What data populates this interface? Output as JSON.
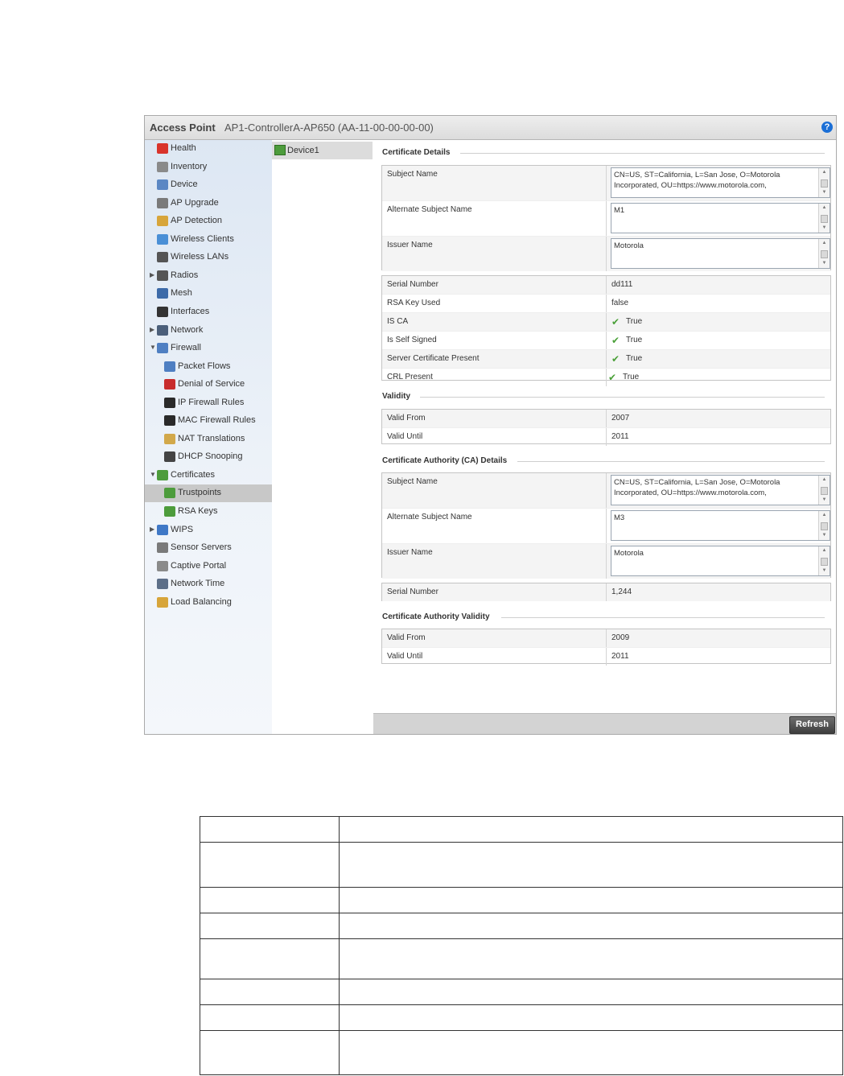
{
  "title": {
    "label": "Access Point",
    "value": "AP1-ControllerA-AP650 (AA-11-00-00-00-00)",
    "help_icon": "help-icon"
  },
  "nav": {
    "items": [
      {
        "label": "Health",
        "icon": "health-icon",
        "color": "#d9342b",
        "level": 0,
        "arrow": ""
      },
      {
        "label": "Inventory",
        "icon": "inventory-icon",
        "color": "#8a8a8a",
        "level": 0,
        "arrow": ""
      },
      {
        "label": "Device",
        "icon": "device-icon",
        "color": "#5b87c4",
        "level": 0,
        "arrow": ""
      },
      {
        "label": "AP Upgrade",
        "icon": "ap-upgrade-icon",
        "color": "#7a7a7a",
        "level": 0,
        "arrow": ""
      },
      {
        "label": "AP Detection",
        "icon": "ap-detection-icon",
        "color": "#d7a53a",
        "level": 0,
        "arrow": ""
      },
      {
        "label": "Wireless Clients",
        "icon": "wireless-clients-icon",
        "color": "#4a8fd6",
        "level": 0,
        "arrow": ""
      },
      {
        "label": "Wireless LANs",
        "icon": "wireless-lans-icon",
        "color": "#555555",
        "level": 0,
        "arrow": ""
      },
      {
        "label": "Radios",
        "icon": "radios-icon",
        "color": "#555555",
        "level": 0,
        "arrow": "▶"
      },
      {
        "label": "Mesh",
        "icon": "mesh-icon",
        "color": "#3c6aa8",
        "level": 0,
        "arrow": ""
      },
      {
        "label": "Interfaces",
        "icon": "interfaces-icon",
        "color": "#333333",
        "level": 0,
        "arrow": ""
      },
      {
        "label": "Network",
        "icon": "network-icon",
        "color": "#4b5f7a",
        "level": 0,
        "arrow": "▶"
      },
      {
        "label": "Firewall",
        "icon": "firewall-icon",
        "color": "#4f7fc2",
        "level": 0,
        "arrow": "▼"
      },
      {
        "label": "Packet Flows",
        "icon": "packet-flows-icon",
        "color": "#4f7fc2",
        "level": 1,
        "arrow": ""
      },
      {
        "label": "Denial of Service",
        "icon": "denial-of-service-icon",
        "color": "#c82c2c",
        "level": 1,
        "arrow": ""
      },
      {
        "label": "IP Firewall Rules",
        "icon": "ip-firewall-rules-icon",
        "color": "#2a2a2a",
        "level": 1,
        "arrow": ""
      },
      {
        "label": "MAC Firewall Rules",
        "icon": "mac-firewall-rules-icon",
        "color": "#2a2a2a",
        "level": 1,
        "arrow": ""
      },
      {
        "label": "NAT Translations",
        "icon": "nat-translations-icon",
        "color": "#d2a84a",
        "level": 1,
        "arrow": ""
      },
      {
        "label": "DHCP Snooping",
        "icon": "dhcp-snooping-icon",
        "color": "#444444",
        "level": 1,
        "arrow": ""
      },
      {
        "label": "Certificates",
        "icon": "certificates-icon",
        "color": "#4d9c3c",
        "level": 0,
        "arrow": "▼"
      },
      {
        "label": "Trustpoints",
        "icon": "trustpoints-icon",
        "color": "#4d9c3c",
        "level": 1,
        "arrow": "",
        "selected": true
      },
      {
        "label": "RSA Keys",
        "icon": "rsa-keys-icon",
        "color": "#4d9c3c",
        "level": 1,
        "arrow": ""
      },
      {
        "label": "WIPS",
        "icon": "wips-icon",
        "color": "#3f78c6",
        "level": 0,
        "arrow": "▶"
      },
      {
        "label": "Sensor Servers",
        "icon": "sensor-servers-icon",
        "color": "#7a7a7a",
        "level": 0,
        "arrow": ""
      },
      {
        "label": "Captive Portal",
        "icon": "captive-portal-icon",
        "color": "#8a8a8a",
        "level": 0,
        "arrow": ""
      },
      {
        "label": "Network Time",
        "icon": "network-time-icon",
        "color": "#5d6f88",
        "level": 0,
        "arrow": ""
      },
      {
        "label": "Load Balancing",
        "icon": "load-balancing-icon",
        "color": "#d7a53a",
        "level": 0,
        "arrow": ""
      }
    ]
  },
  "devices": {
    "selected_label": "Device1",
    "icon": "device-cert-icon"
  },
  "cert_details": {
    "title": "Certificate Details",
    "subject_name": {
      "label": "Subject Name",
      "value": "CN=US, ST=California, L=San Jose, O=Motorola Incorporated, OU=https://www.motorola.com,"
    },
    "alt_subject_name": {
      "label": "Alternate Subject Name",
      "value": "M1"
    },
    "issuer_name": {
      "label": "Issuer Name",
      "value": "Motorola"
    }
  },
  "cert_props": {
    "serial_number": {
      "label": "Serial Number",
      "value": "dd111"
    },
    "rsa_key_used": {
      "label": "RSA Key Used",
      "value": "false"
    },
    "is_ca": {
      "label": "IS CA",
      "value": "True"
    },
    "is_self_signed": {
      "label": "Is Self Signed",
      "value": "True"
    },
    "server_cert_present": {
      "label": "Server Certificate Present",
      "value": "True"
    },
    "crl_present": {
      "label": "CRL Present",
      "value": "True"
    },
    "check_icon": "check-icon"
  },
  "validity": {
    "title": "Validity",
    "valid_from": {
      "label": "Valid From",
      "value": "2007"
    },
    "valid_until": {
      "label": "Valid Until",
      "value": "2011"
    }
  },
  "ca_details": {
    "title": "Certificate Authority (CA) Details",
    "subject_name": {
      "label": "Subject Name",
      "value": "CN=US, ST=California, L=San Jose, O=Motorola Incorporated, OU=https://www.motorola.com,"
    },
    "alt_subject_name": {
      "label": "Alternate Subject Name",
      "value": "M3"
    },
    "issuer_name": {
      "label": "Issuer Name",
      "value": "Motorola"
    },
    "serial_number": {
      "label": "Serial Number",
      "value": "1,244"
    }
  },
  "ca_validity": {
    "title": "Certificate Authority Validity",
    "valid_from": {
      "label": "Valid From",
      "value": "2009"
    },
    "valid_until": {
      "label": "Valid Until",
      "value": "2011"
    }
  },
  "footer": {
    "refresh_label": "Refresh"
  }
}
